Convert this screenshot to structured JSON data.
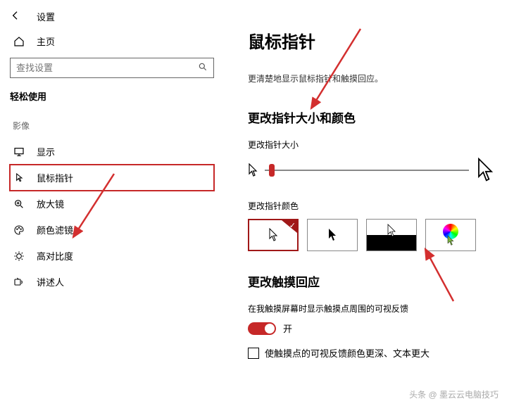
{
  "header": {
    "app_title": "设置"
  },
  "sidebar": {
    "home": "主页",
    "search_placeholder": "查找设置",
    "section": "轻松使用",
    "group_vision": "影像",
    "items": {
      "display": "显示",
      "mouse_pointer": "鼠标指针",
      "magnifier": "放大镜",
      "color_filters": "颜色滤镜",
      "high_contrast": "高对比度",
      "narrator": "讲述人"
    }
  },
  "main": {
    "title": "鼠标指针",
    "subtitle": "更清楚地显示鼠标指针和触摸回应。",
    "section_size_color": "更改指针大小和颜色",
    "label_size": "更改指针大小",
    "label_color": "更改指针颜色",
    "section_touch": "更改触摸回应",
    "touch_desc": "在我触摸屏幕时显示触摸点周围的可视反馈",
    "toggle_on": "开",
    "checkbox_label": "使触摸点的可视反馈颜色更深、文本更大"
  },
  "watermark": "头条 @ 墨云云电脑技巧"
}
